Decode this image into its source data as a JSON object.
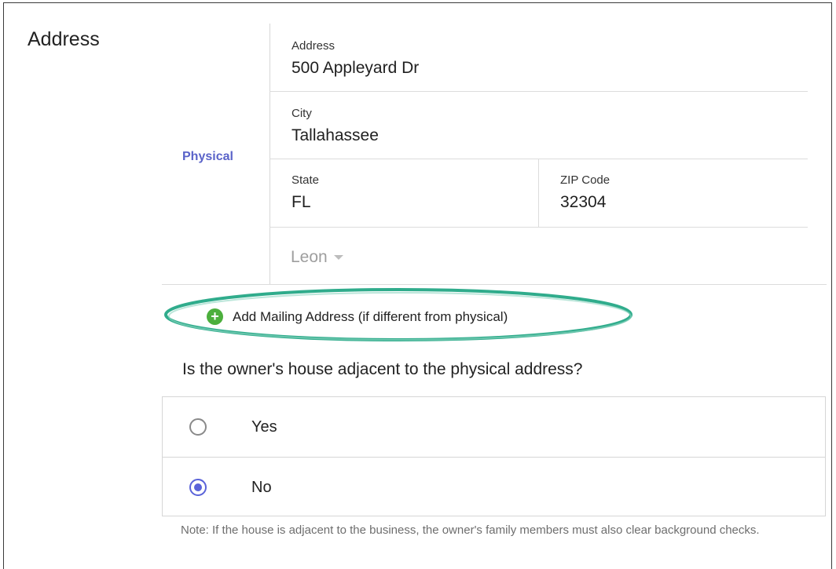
{
  "section": {
    "title": "Address"
  },
  "physical": {
    "label": "Physical",
    "address": {
      "label": "Address",
      "value": "500 Appleyard Dr"
    },
    "city": {
      "label": "City",
      "value": "Tallahassee"
    },
    "state": {
      "label": "State",
      "value": "FL"
    },
    "zip": {
      "label": "ZIP Code",
      "value": "32304"
    },
    "county": {
      "value": "Leon"
    }
  },
  "mailing": {
    "add_label": "Add Mailing Address (if different from physical)",
    "icon": "plus-circle-icon",
    "highlight_color": "#1aa37f"
  },
  "adjacency": {
    "question": "Is the owner's house adjacent to the physical address?",
    "options": [
      {
        "label": "Yes",
        "selected": false
      },
      {
        "label": "No",
        "selected": true
      }
    ],
    "note": "Note: If the house is adjacent to the business, the owner's family members must also clear background checks."
  },
  "colors": {
    "accent": "#5a63d9",
    "physical_label": "#5a63c9",
    "add_icon": "#4caf3d"
  }
}
